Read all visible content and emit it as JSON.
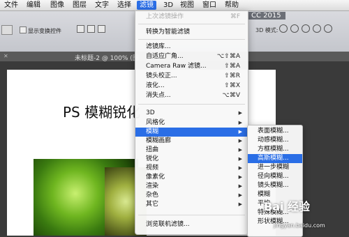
{
  "menubar": {
    "items": [
      "文件",
      "编辑",
      "图像",
      "图层",
      "文字",
      "选择",
      "滤镜",
      "3D",
      "视图",
      "窗口",
      "帮助"
    ],
    "active_index": 6
  },
  "app": {
    "name": "CC 2015"
  },
  "options_bar": {
    "show_transform_label": "显示变换控件",
    "mode_label": "3D 模式:"
  },
  "document": {
    "tab_title": "未标题-2 @ 100% (图"
  },
  "canvas": {
    "heading": "PS 模糊锐化"
  },
  "filter_menu": {
    "items": [
      {
        "label": "上次滤镜操作",
        "shortcut": "⌘F",
        "disabled": true
      },
      {
        "label": "转换为智能滤镜",
        "shortcut": ""
      },
      {
        "label": "滤镜库...",
        "shortcut": ""
      },
      {
        "label": "自适应广角...",
        "shortcut": "⌥⇧⌘A"
      },
      {
        "label": "Camera Raw 滤镜...",
        "shortcut": "⇧⌘A"
      },
      {
        "label": "镜头校正...",
        "shortcut": "⇧⌘R"
      },
      {
        "label": "液化...",
        "shortcut": "⇧⌘X"
      },
      {
        "label": "消失点...",
        "shortcut": "⌥⌘V"
      },
      {
        "label": "3D",
        "submenu": true
      },
      {
        "label": "风格化",
        "submenu": true
      },
      {
        "label": "模糊",
        "submenu": true,
        "highlighted": true
      },
      {
        "label": "模糊画廊",
        "submenu": true
      },
      {
        "label": "扭曲",
        "submenu": true
      },
      {
        "label": "锐化",
        "submenu": true
      },
      {
        "label": "视频",
        "submenu": true
      },
      {
        "label": "像素化",
        "submenu": true
      },
      {
        "label": "渲染",
        "submenu": true
      },
      {
        "label": "杂色",
        "submenu": true
      },
      {
        "label": "其它",
        "submenu": true
      },
      {
        "label": "浏览联机滤镜...",
        "shortcut": ""
      }
    ]
  },
  "blur_submenu": {
    "items": [
      "表面模糊...",
      "动感模糊...",
      "方框模糊...",
      "高斯模糊...",
      "进一步模糊",
      "径向模糊...",
      "镜头模糊...",
      "模糊",
      "平均",
      "特殊模糊...",
      "形状模糊..."
    ],
    "highlighted_index": 3
  },
  "watermark": {
    "text": "Bai 经验",
    "url": "jingyan.baidu.com"
  },
  "colors": {
    "highlight": "#2a6ee6"
  }
}
